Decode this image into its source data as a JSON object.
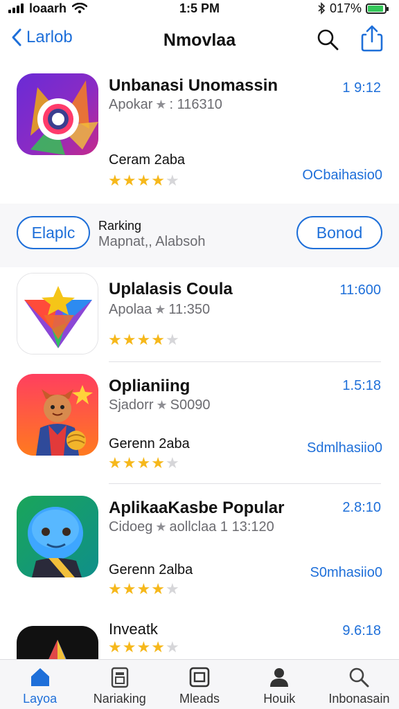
{
  "status_bar": {
    "carrier": "loaarh",
    "time": "1:5 PM",
    "battery_text": "017%",
    "battery_level": 0.9
  },
  "nav": {
    "back_label": "Larlob",
    "title": "Nmovlaa",
    "icons": [
      "search-icon",
      "share-icon"
    ]
  },
  "apps": [
    {
      "name": "Unbanasi Unomassin",
      "subtitle_a": "Apokar",
      "subtitle_b": ": 116310",
      "size": "1 9:12",
      "extra": "Ceram 2aba",
      "action": "OCbaihasio0",
      "rating": 4,
      "icon": "camera-icon"
    },
    {
      "name": "Uplalasis Coula",
      "subtitle_a": "Apolaa",
      "subtitle_b": "11:350",
      "size": "11:600",
      "extra": "",
      "action": "",
      "rating": 4,
      "icon": "triangle-icon"
    },
    {
      "name": "Oplianiing",
      "subtitle_a": "Sjadorr",
      "subtitle_b": "S0090",
      "size": "1.5:18",
      "extra": "Gerenn 2aba",
      "action": "Sdmlhasiio0",
      "rating": 4,
      "icon": "character-icon"
    },
    {
      "name": "AplikaaKasbe Popular",
      "subtitle_a": "Cidoeg",
      "subtitle_b": "aollclaa 1 13:120",
      "size": "2.8:10",
      "extra": "Gerenn 2alba",
      "action": "S0mhasiio0",
      "rating": 4,
      "icon": "mascot-icon"
    },
    {
      "name": "Inveatk",
      "subtitle_a": "",
      "subtitle_b": "",
      "size": "9.6:18",
      "extra": "",
      "action": "",
      "rating": 4,
      "icon": "pyramid-icon"
    }
  ],
  "ranking": {
    "left_button": "Elaplc",
    "label": "Rarking",
    "sublabel": "Mapnat,, Alabsoh",
    "right_button": "Bonod"
  },
  "tabs": [
    {
      "label": "Layoa",
      "icon": "home-icon",
      "active": true
    },
    {
      "label": "Nariaking",
      "icon": "ranking-icon",
      "active": false
    },
    {
      "label": "Mleads",
      "icon": "apps-icon",
      "active": false
    },
    {
      "label": "Houik",
      "icon": "person-icon",
      "active": false
    },
    {
      "label": "Inbonasain",
      "icon": "search-icon",
      "active": false
    }
  ],
  "colors": {
    "accent": "#1e6fd9",
    "star": "#f6b81b",
    "star_off": "#d6d6d9",
    "battery": "#34c759"
  }
}
